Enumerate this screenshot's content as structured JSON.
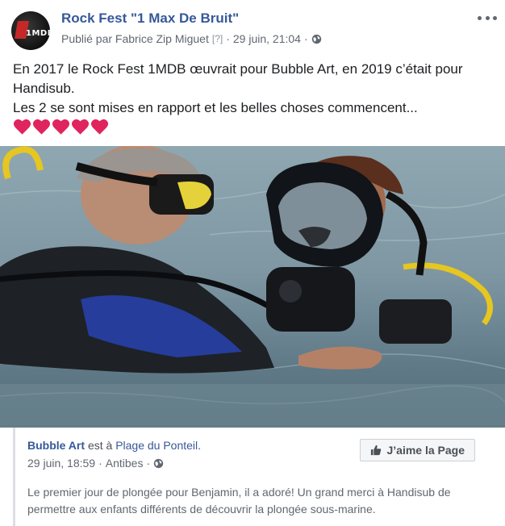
{
  "post": {
    "page_name": "Rock Fest \"1 Max De Bruit\"",
    "published_by": "Publié par Fabrice Zip Miguet",
    "bracket": "[?]",
    "separator": "·",
    "timestamp": "29 juin, 21:04",
    "separator2": "·",
    "text_line1": "En 2017 le Rock Fest 1MDB œuvrait pour Bubble Art, en 2019 c’était pour Handisub.",
    "text_line2": "Les 2 se sont mises en rapport et les belles choses commencent...",
    "hearts_count": 5,
    "avatar_logo": "1MDB"
  },
  "shared": {
    "page": "Bubble Art",
    "is_at": "est à",
    "place": "Plage du Ponteil",
    "period": ".",
    "date": "29 juin, 18:59",
    "sep": "·",
    "location": "Antibes",
    "sep2": "·",
    "like_label": "J’aime la Page",
    "description": "Le premier jour de plongée pour Benjamin, il a adoré! Un grand merci à Handisub de permettre aux enfants différents de découvrir la plongée sous-marine."
  },
  "icons": {
    "globe": "globe-icon",
    "more": "more-options-icon",
    "thumb": "thumbs-up-icon",
    "heart": "red-heart-icon"
  },
  "colors": {
    "link": "#365899",
    "heart": "#e0245e",
    "meta": "#616770"
  }
}
